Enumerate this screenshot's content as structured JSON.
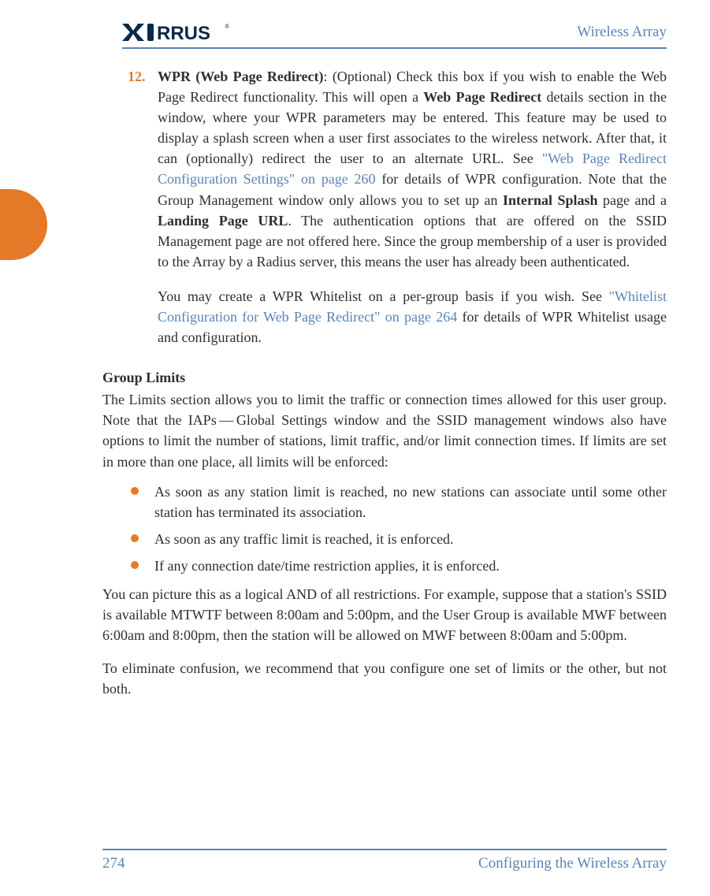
{
  "header": {
    "logo_alt": "XIRRUS",
    "title": "Wireless Array"
  },
  "item": {
    "number": "12.",
    "bold_intro": "WPR (Web Page Redirect)",
    "text_1a": ": (Optional) Check this box if you wish to enable the Web Page Redirect functionality. This will open a ",
    "bold_webpage": "Web Page Redirect",
    "text_1b": " details section in the window, where your WPR parameters may be entered. This feature may be used to display a splash screen when a user first associates to the wireless network. After that, it can (optionally) redirect the user to an alternate URL. See ",
    "link_1": "\"Web Page Redirect Configuration Settings\" on page 260",
    "text_1c": " for details of WPR configuration. Note that the Group Management window only allows you to set up an ",
    "bold_internal": "Internal Splash",
    "text_1d": " page and a ",
    "bold_landing": "Landing Page URL",
    "text_1e": ". The authentication options that are offered on the SSID Management page are not offered here. Since the group membership of a user is provided to the Array by a Radius server, this means the user has already been authenticated.",
    "text_2a": "You may create a WPR Whitelist on a per-group basis if you wish. See ",
    "link_2": "\"Whitelist Configuration for Web Page Redirect\" on page 264",
    "text_2b": " for details of WPR Whitelist usage and configuration."
  },
  "section": {
    "heading": "Group Limits",
    "intro": "The Limits section allows you to limit the traffic or connection times allowed for this user group. Note that the IAPs — Global Settings window and the SSID management windows also have options to limit the number of stations, limit traffic, and/or limit connection times. If limits are set in more than one place, all limits will be enforced:",
    "bullets": [
      "As soon as any station limit is reached, no new stations can associate until some other station has terminated its association.",
      "As soon as any traffic limit is reached, it is enforced.",
      "If any connection date/time restriction applies, it is enforced."
    ],
    "after_1": "You can picture this as a logical AND of all restrictions. For example, suppose that a station's SSID is available MTWTF between 8:00am and 5:00pm, and the User Group is available MWF between 6:00am and 8:00pm, then the station will be allowed on MWF between 8:00am and 5:00pm.",
    "after_2": "To eliminate confusion, we recommend that you configure one set of limits or the other, but not both."
  },
  "footer": {
    "page": "274",
    "section": "Configuring the Wireless Array"
  }
}
